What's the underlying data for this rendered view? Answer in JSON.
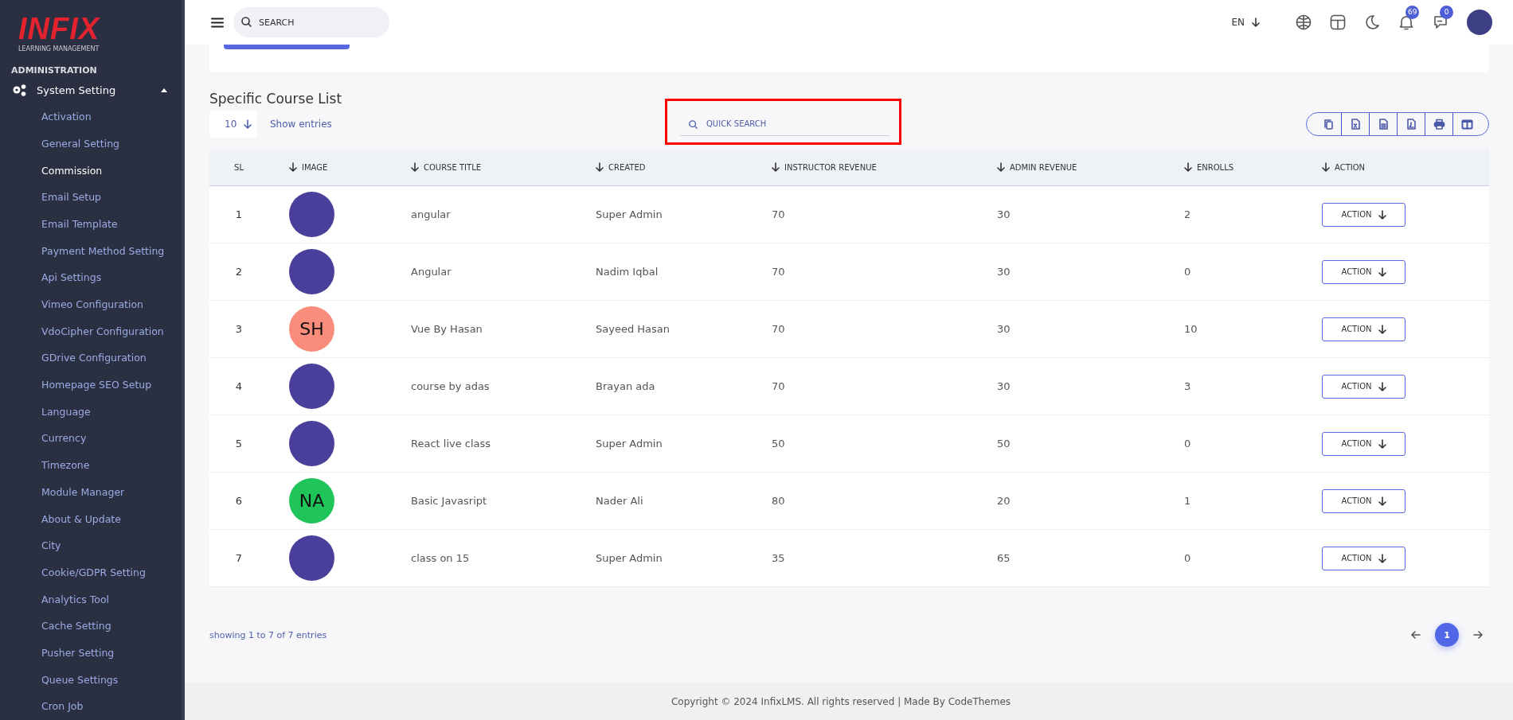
{
  "sidebar": {
    "logo": {
      "wordmark": "INFIX",
      "tagline": "LEARNING MANAGEMENT"
    },
    "section": "ADMINISTRATION",
    "group": {
      "label": "System Setting",
      "expanded": true,
      "items": [
        {
          "label": "Activation",
          "selected": false
        },
        {
          "label": "General Setting",
          "selected": false
        },
        {
          "label": "Commission",
          "selected": true
        },
        {
          "label": "Email Setup",
          "selected": false
        },
        {
          "label": "Email Template",
          "selected": false
        },
        {
          "label": "Payment Method Setting",
          "selected": false
        },
        {
          "label": "Api Settings",
          "selected": false
        },
        {
          "label": "Vimeo Configuration",
          "selected": false
        },
        {
          "label": "VdoCipher Configuration",
          "selected": false
        },
        {
          "label": "GDrive Configuration",
          "selected": false
        },
        {
          "label": "Homepage SEO Setup",
          "selected": false
        },
        {
          "label": "Language",
          "selected": false
        },
        {
          "label": "Currency",
          "selected": false
        },
        {
          "label": "Timezone",
          "selected": false
        },
        {
          "label": "Module Manager",
          "selected": false
        },
        {
          "label": "About & Update",
          "selected": false
        },
        {
          "label": "City",
          "selected": false
        },
        {
          "label": "Cookie/GDPR Setting",
          "selected": false
        },
        {
          "label": "Analytics Tool",
          "selected": false
        },
        {
          "label": "Cache Setting",
          "selected": false
        },
        {
          "label": "Pusher Setting",
          "selected": false
        },
        {
          "label": "Queue Settings",
          "selected": false
        },
        {
          "label": "Cron Job",
          "selected": false
        }
      ]
    }
  },
  "header": {
    "search": {
      "placeholder": "SEARCH"
    },
    "language": "EN",
    "notifications": "69",
    "messages": "0"
  },
  "page": {
    "title": "Specific Course List",
    "page_size": "10",
    "show_entries": "Show entries",
    "quick_search": {
      "placeholder": "QUICK SEARCH",
      "highlighted": true
    }
  },
  "table": {
    "columns": [
      {
        "label": "SL",
        "sortable": false
      },
      {
        "label": "IMAGE",
        "sortable": true
      },
      {
        "label": "COURSE TITLE",
        "sortable": true
      },
      {
        "label": "CREATED",
        "sortable": true
      },
      {
        "label": "INSTRUCTOR REVENUE",
        "sortable": true
      },
      {
        "label": "ADMIN REVENUE",
        "sortable": true
      },
      {
        "label": "ENROLLS",
        "sortable": true
      },
      {
        "label": "ACTION",
        "sortable": true
      }
    ],
    "rows": [
      {
        "sl": "1",
        "image": {
          "kind": "photo"
        },
        "title": "angular",
        "created": "Super Admin",
        "instructor_revenue": "70",
        "admin_revenue": "30",
        "enrolls": "2",
        "action": "ACTION"
      },
      {
        "sl": "2",
        "image": {
          "kind": "photo"
        },
        "title": "Angular",
        "created": "Nadim Iqbal",
        "instructor_revenue": "70",
        "admin_revenue": "30",
        "enrolls": "0",
        "action": "ACTION"
      },
      {
        "sl": "3",
        "image": {
          "kind": "initials",
          "text": "SH",
          "color": "#fa8c7c"
        },
        "title": "Vue By Hasan",
        "created": "Sayeed Hasan",
        "instructor_revenue": "70",
        "admin_revenue": "30",
        "enrolls": "10",
        "action": "ACTION"
      },
      {
        "sl": "4",
        "image": {
          "kind": "photo"
        },
        "title": "course by adas",
        "created": "Brayan ada",
        "instructor_revenue": "70",
        "admin_revenue": "30",
        "enrolls": "3",
        "action": "ACTION"
      },
      {
        "sl": "5",
        "image": {
          "kind": "photo"
        },
        "title": "React live class",
        "created": "Super Admin",
        "instructor_revenue": "50",
        "admin_revenue": "50",
        "enrolls": "0",
        "action": "ACTION"
      },
      {
        "sl": "6",
        "image": {
          "kind": "initials",
          "text": "NA",
          "color": "#1fc55a"
        },
        "title": "Basic Javasript",
        "created": "Nader Ali",
        "instructor_revenue": "80",
        "admin_revenue": "20",
        "enrolls": "1",
        "action": "ACTION"
      },
      {
        "sl": "7",
        "image": {
          "kind": "photo"
        },
        "title": "class on 15",
        "created": "Super Admin",
        "instructor_revenue": "35",
        "admin_revenue": "65",
        "enrolls": "0",
        "action": "ACTION"
      }
    ]
  },
  "showing": "showing 1 to 7 of 7 entries",
  "pagination": {
    "pages": [
      {
        "label": "1",
        "selected": true
      }
    ]
  },
  "footer": "Copyright © 2024 InfixLMS. All rights reserved | Made By CodeThemes"
}
